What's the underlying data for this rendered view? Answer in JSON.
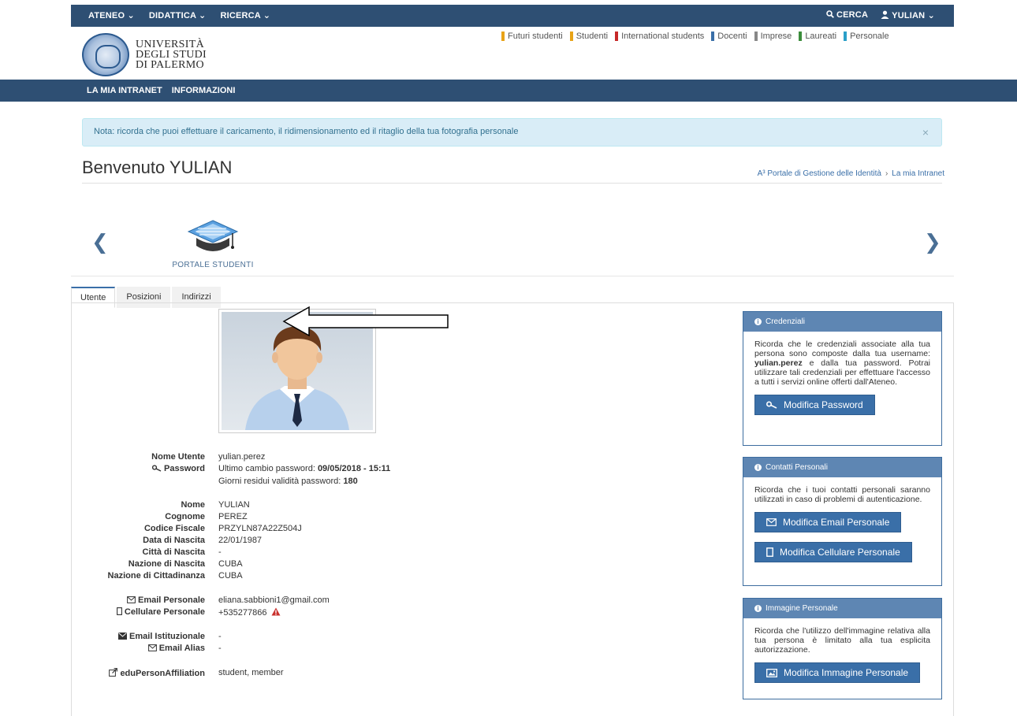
{
  "topnav": {
    "items": [
      "ATENEO ⌄",
      "DIDATTICA ⌄",
      "RICERCA ⌄"
    ],
    "search": "CERCA",
    "user": "YULIAN ⌄"
  },
  "university": {
    "line1": "UNIVERSITÀ",
    "line2": "DEGLI STUDI",
    "line3": "DI PALERMO"
  },
  "audience": [
    {
      "label": "Futuri studenti",
      "color": "#e8a317"
    },
    {
      "label": "Studenti",
      "color": "#e8a317"
    },
    {
      "label": "International students",
      "color": "#c62828"
    },
    {
      "label": "Docenti",
      "color": "#3a6fa8"
    },
    {
      "label": "Imprese",
      "color": "#888888"
    },
    {
      "label": "Laureati",
      "color": "#3c8d3c"
    },
    {
      "label": "Personale",
      "color": "#2a9fc8"
    }
  ],
  "secondnav": {
    "item1": "LA MIA INTRANET",
    "item2": "INFORMAZIONI"
  },
  "notice": {
    "text": "Nota: ricorda che puoi effettuare il caricamento, il ridimensionamento ed il ritaglio della tua fotografia personale",
    "close": "×"
  },
  "welcome": "Benvenuto YULIAN",
  "breadcrumb": {
    "item1": "A³ Portale di Gestione delle Identità",
    "sep": "›",
    "item2": "La mia Intranet"
  },
  "carousel": {
    "prev": "❮",
    "next": "❯",
    "portal_label": "PORTALE STUDENTI"
  },
  "tabs": [
    "Utente",
    "Posizioni",
    "Indirizzi"
  ],
  "user": {
    "labels": {
      "username": "Nome Utente",
      "password": "Password",
      "nome": "Nome",
      "cognome": "Cognome",
      "cf": "Codice Fiscale",
      "nascita": "Data di Nascita",
      "citta": "Città di Nascita",
      "nazione_nascita": "Nazione di Nascita",
      "cittadinanza": "Nazione di Cittadinanza",
      "email_personale": "Email Personale",
      "cellulare": "Cellulare Personale",
      "email_ist": "Email Istituzionale",
      "email_alias": "Email Alias",
      "affiliation": "eduPersonAffiliation"
    },
    "values": {
      "username": "yulian.perez",
      "password_change_prefix": "Ultimo cambio password: ",
      "password_change_value": "09/05/2018 - 15:11",
      "password_days_prefix": "Giorni residui validità password: ",
      "password_days_value": "180",
      "nome": "YULIAN",
      "cognome": "PEREZ",
      "cf": "PRZYLN87A22Z504J",
      "nascita": "22/01/1987",
      "citta": "-",
      "nazione_nascita": "CUBA",
      "cittadinanza": "CUBA",
      "email_personale": "eliana.sabbioni1@gmail.com",
      "cellulare": "+535277866",
      "email_ist": "-",
      "email_alias": "-",
      "affiliation": "student, member"
    }
  },
  "panels": {
    "credenziali": {
      "title": "Credenziali",
      "text_a": "Ricorda che le credenziali associate alla tua persona sono composte dalla tua username: ",
      "username": "yulian.perez",
      "text_b": " e dalla tua password. Potrai utilizzare tali credenziali per effettuare l'accesso a tutti i servizi online offerti dall'Ateneo.",
      "button": "Modifica Password"
    },
    "contatti": {
      "title": "Contatti Personali",
      "text": "Ricorda che i tuoi contatti personali saranno utilizzati in caso di problemi di autenticazione.",
      "button_email": "Modifica Email Personale",
      "button_cell": "Modifica Cellulare Personale"
    },
    "immagine": {
      "title": "Immagine Personale",
      "text": "Ricorda che l'utilizzo dell'immagine relativa alla tua persona è limitato alla tua esplicita autorizzazione.",
      "button": "Modifica Immagine Personale"
    }
  }
}
